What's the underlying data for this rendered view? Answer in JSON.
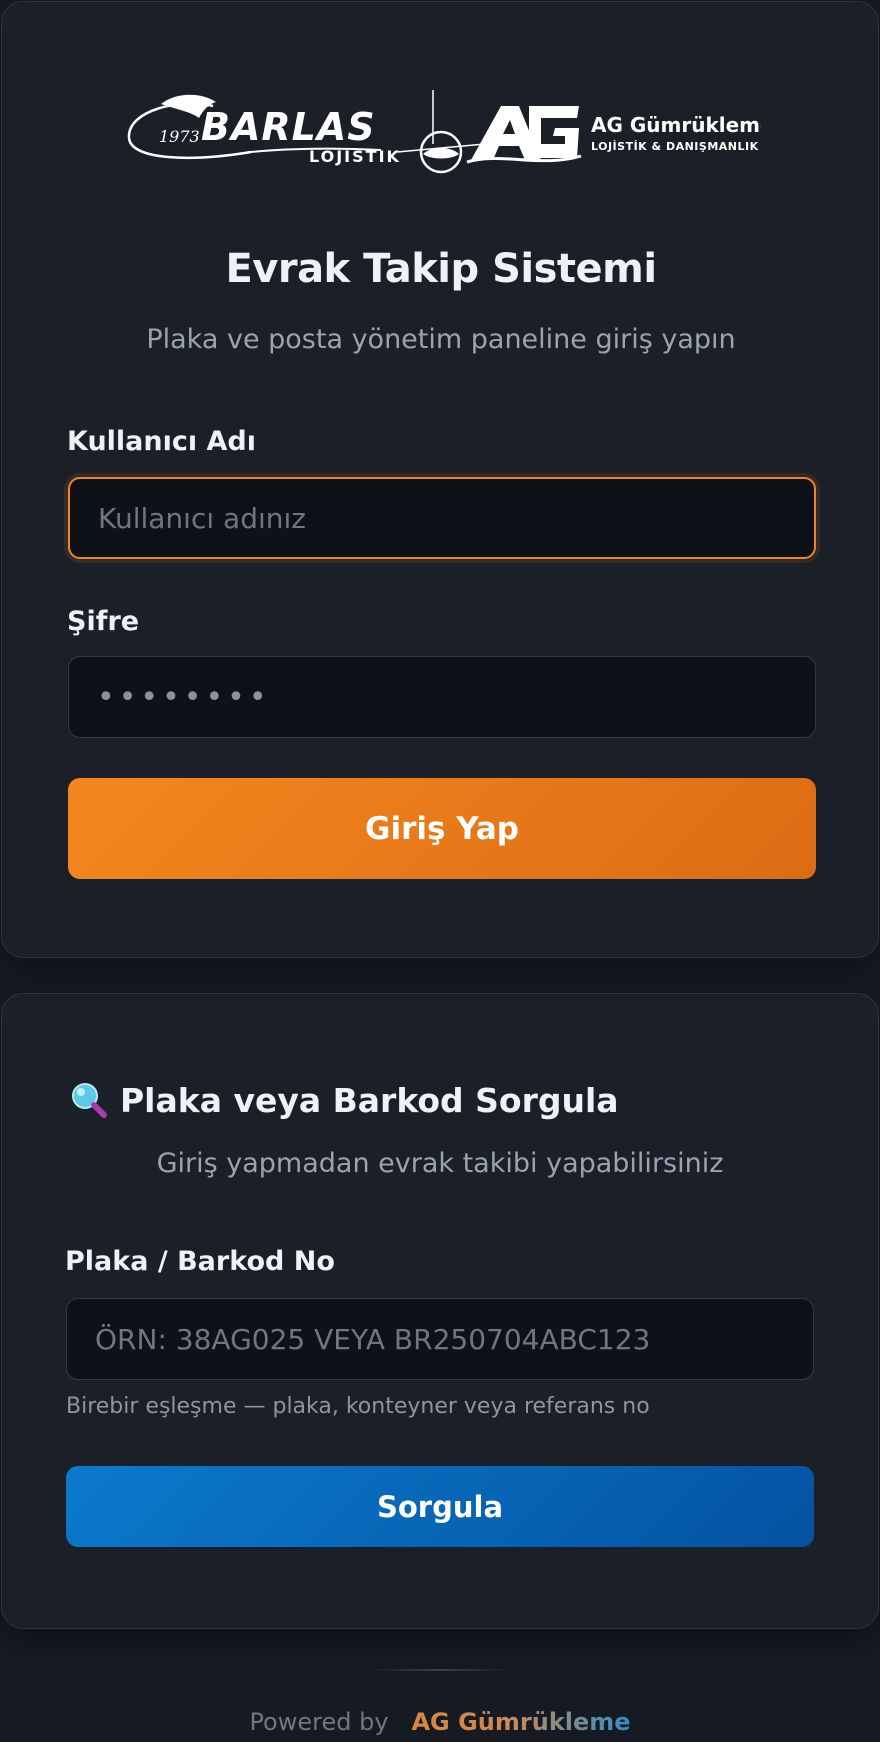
{
  "logo": {
    "year": "1973",
    "left_brand": "BARLAS",
    "left_sub": "LOJISTIK",
    "right_mark": "AG",
    "right_brand": "AG Gümrükleme",
    "right_sub": "LOJİSTİK & DANIŞMANLIK"
  },
  "login": {
    "title": "Evrak Takip Sistemi",
    "subtitle": "Plaka ve posta yönetim paneline giriş yapın",
    "username_label": "Kullanıcı Adı",
    "username_placeholder": "Kullanıcı adınız",
    "username_value": "",
    "password_label": "Şifre",
    "password_value": "••••••••",
    "submit_label": "Giriş Yap"
  },
  "query": {
    "icon": "magnifier-icon",
    "title": "Plaka veya Barkod Sorgula",
    "subtitle": "Giriş yapmadan evrak takibi yapabilirsiniz",
    "field_label": "Plaka / Barkod No",
    "field_placeholder": "ÖRN: 38AG025 VEYA BR250704ABC123",
    "field_value": "",
    "hint": "Birebir eşleşme — plaka, konteyner veya referans no",
    "submit_label": "Sorgula"
  },
  "footer": {
    "prefix": "Powered by",
    "brand": "AG Gümrükleme"
  },
  "colors": {
    "accent_orange": "#f08323",
    "accent_blue": "#0b6fc0",
    "background": "#161a22",
    "card": "#1b1f27"
  }
}
